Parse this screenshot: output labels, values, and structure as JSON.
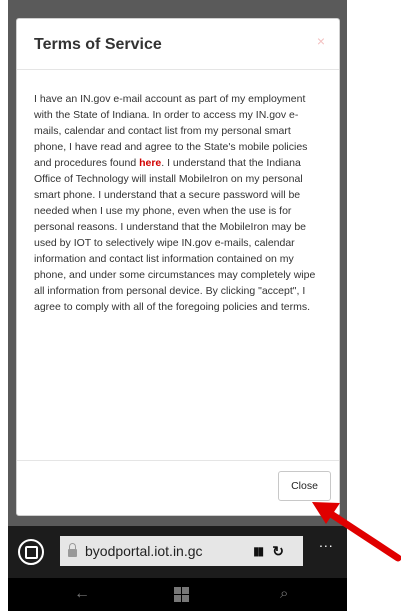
{
  "modal": {
    "title": "Terms of Service",
    "close_x": "×",
    "body_before_link": "I have an IN.gov e-mail account as part of my employment with the State of Indiana. In order to access my IN.gov e-mails, calendar and contact list from my personal smart phone, I have read and agree to the State's mobile policies and procedures found ",
    "link_text": "here",
    "body_after_link": ". I understand that the Indiana Office of Technology will install MobileIron on my personal smart phone. I understand that a secure password will be needed when I use my phone, even when the use is for personal reasons. I understand that the MobileIron may be used by IOT to selectively wipe IN.gov e-mails, calendar information and contact list information contained on my phone, and under some circumstances may completely wipe all information from personal device. By clicking \"accept\", I agree to comply with all of the foregoing policies and terms.",
    "close_button": "Close"
  },
  "browser": {
    "url": "byodportal.iot.in.gc",
    "more": "..."
  },
  "colors": {
    "link": "#d00000",
    "arrow": "#e00000"
  }
}
